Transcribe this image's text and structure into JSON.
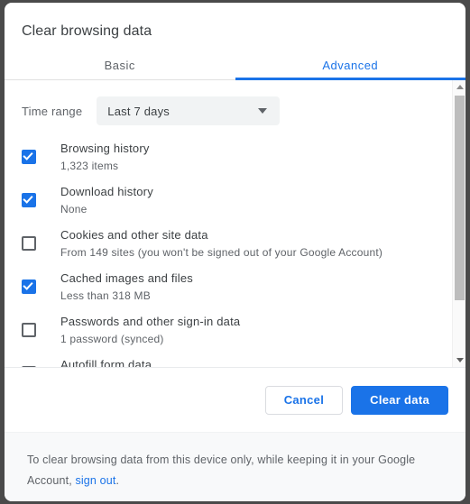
{
  "dialog": {
    "title": "Clear browsing data"
  },
  "tabs": [
    {
      "label": "Basic",
      "active": false
    },
    {
      "label": "Advanced",
      "active": true
    }
  ],
  "time_range": {
    "label": "Time range",
    "selected": "Last 7 days",
    "caret_icon": "chevron-down-icon"
  },
  "items": [
    {
      "label": "Browsing history",
      "sub": "1,323 items",
      "checked": true
    },
    {
      "label": "Download history",
      "sub": "None",
      "checked": true
    },
    {
      "label": "Cookies and other site data",
      "sub": "From 149 sites (you won't be signed out of your Google Account)",
      "checked": false
    },
    {
      "label": "Cached images and files",
      "sub": "Less than 318 MB",
      "checked": true
    },
    {
      "label": "Passwords and other sign-in data",
      "sub": "1 password (synced)",
      "checked": false
    },
    {
      "label": "Autofill form data",
      "sub": "",
      "checked": false
    }
  ],
  "scrollbar": {
    "up_arrow_icon": "triangle-up-icon",
    "down_arrow_icon": "triangle-down-icon"
  },
  "actions": {
    "cancel_label": "Cancel",
    "confirm_label": "Clear data"
  },
  "footer": {
    "text_before": "To clear browsing data from this device only, while keeping it in your Google Account, ",
    "link_label": "sign out",
    "text_after": "."
  },
  "colors": {
    "accent": "#1a73e8",
    "text_primary": "#3c4043",
    "text_secondary": "#5f6368",
    "select_bg": "#f1f3f4",
    "footer_bg": "#f8f9fa",
    "backdrop": "#4a4a4a"
  }
}
